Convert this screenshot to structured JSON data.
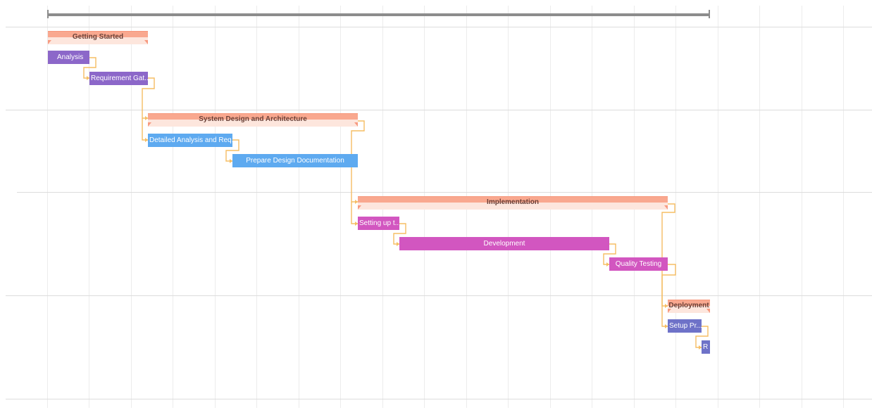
{
  "colors": {
    "phase": "#f9a88f",
    "phase_text": "#6a4037",
    "getting_started_task": "#8c67c9",
    "design_task": "#5eaaf0",
    "implementation_task": "#d256c0",
    "deployment_task": "#6e72c8",
    "connector": "#f5bd63",
    "summary_bar": "#8c8c8c"
  },
  "gantt": {
    "phases": [
      {
        "id": "p1",
        "label": "Getting Started"
      },
      {
        "id": "p2",
        "label": "System Design and Architecture"
      },
      {
        "id": "p3",
        "label": "Implementation"
      },
      {
        "id": "p4",
        "label": "Deployment"
      }
    ],
    "tasks": [
      {
        "id": "t1",
        "label": "Analysis",
        "phase": "p1"
      },
      {
        "id": "t2",
        "label": "Requirement Gat...",
        "phase": "p1"
      },
      {
        "id": "t3",
        "label": "Detailed Analysis and Req...",
        "phase": "p2"
      },
      {
        "id": "t4",
        "label": "Prepare Design Documentation",
        "phase": "p2"
      },
      {
        "id": "t5",
        "label": "Setting up t...",
        "phase": "p3"
      },
      {
        "id": "t6",
        "label": "Development",
        "phase": "p3"
      },
      {
        "id": "t7",
        "label": "Quality Testing",
        "phase": "p3"
      },
      {
        "id": "t8",
        "label": "Setup Pr...",
        "phase": "p4"
      },
      {
        "id": "t9",
        "label": "R",
        "phase": "p4"
      }
    ]
  }
}
